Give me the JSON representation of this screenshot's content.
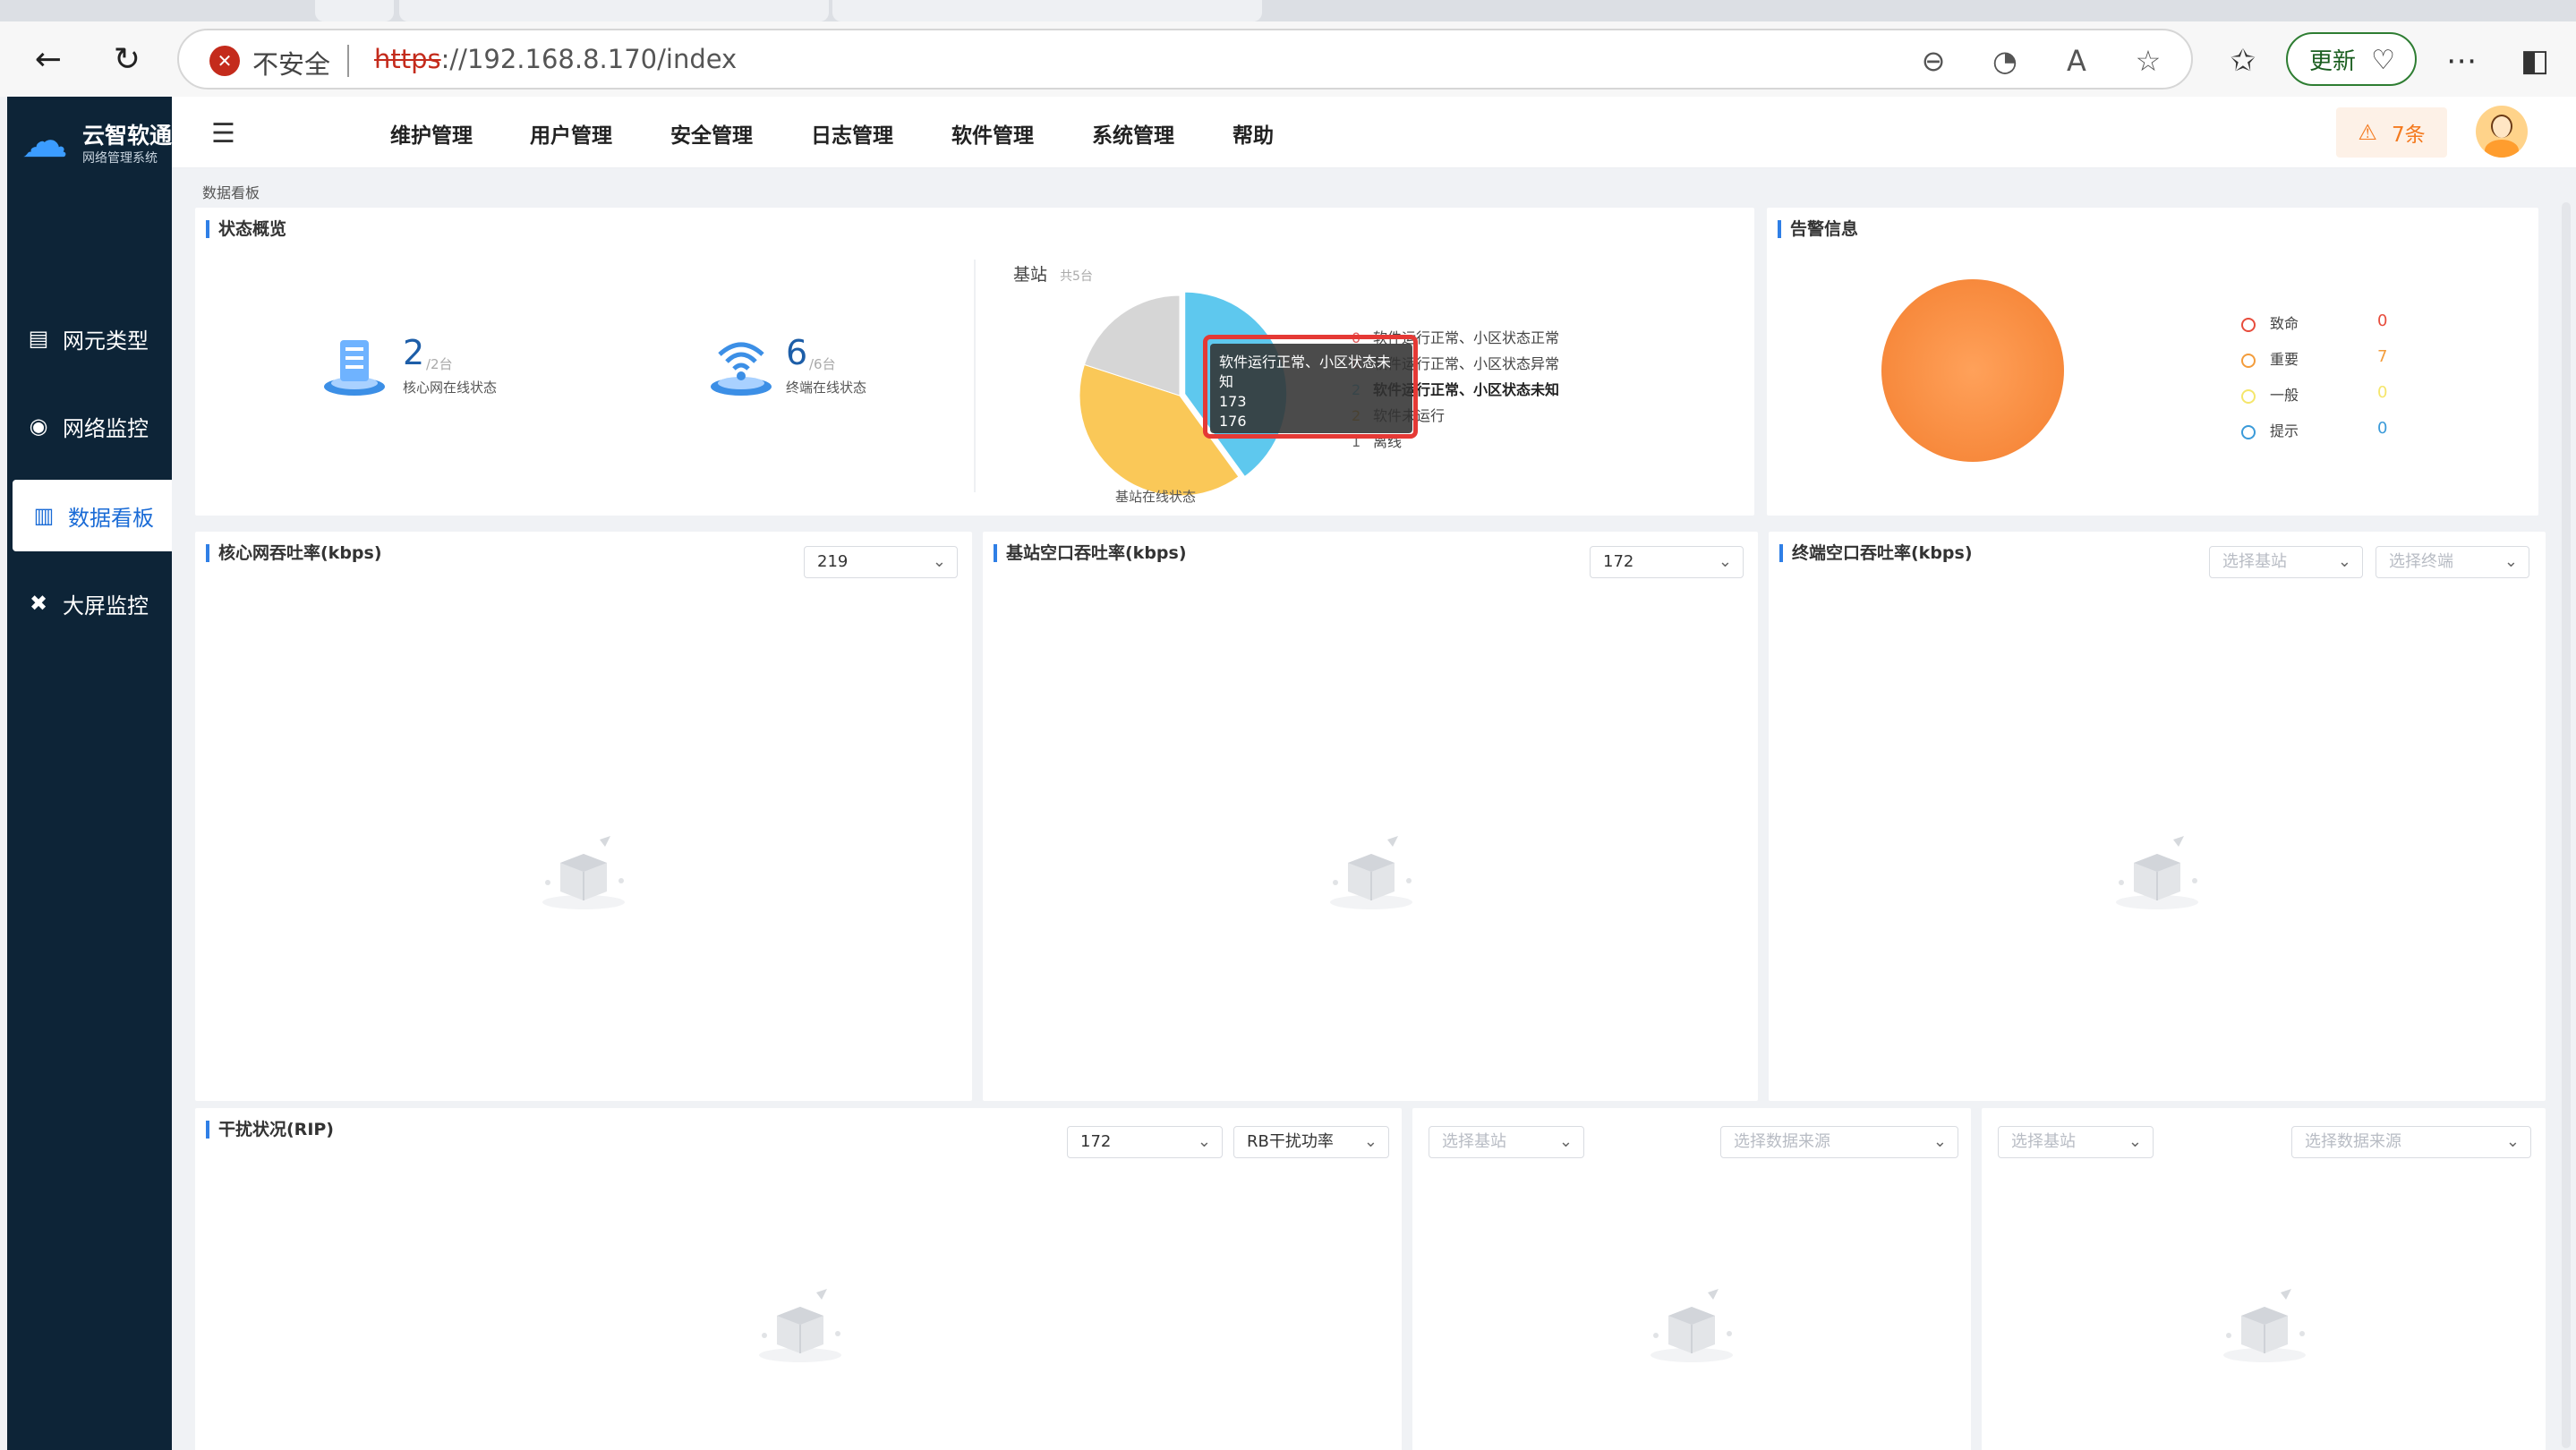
{
  "browser": {
    "insecure_label": "不安全",
    "url_scheme": "https",
    "url_rest": "://192.168.8.170/index",
    "update_label": "更新"
  },
  "app": {
    "logo_title": "云智软通",
    "logo_subtitle": "网络管理系统",
    "sidebar": [
      {
        "label": "网元类型",
        "icon": "server-icon"
      },
      {
        "label": "网络监控",
        "icon": "monitor-icon"
      },
      {
        "label": "数据看板",
        "icon": "chart-icon"
      },
      {
        "label": "大屏监控",
        "icon": "expand-icon"
      }
    ],
    "menu": [
      "维护管理",
      "用户管理",
      "安全管理",
      "日志管理",
      "软件管理",
      "系统管理",
      "帮助"
    ],
    "alarm_count": "7条",
    "breadcrumb": "数据看板"
  },
  "status": {
    "title": "状态概览",
    "core": {
      "value": "2",
      "total": "/2台",
      "label": "核心网在线状态"
    },
    "terminal": {
      "value": "6",
      "total": "/6台",
      "label": "终端在线状态"
    },
    "bs_title": "基站",
    "bs_total": "共5台",
    "bs_caption": "基站在线状态",
    "legend": [
      {
        "count": "0",
        "label": "软件运行正常、小区状态正常",
        "color": "#91cc75"
      },
      {
        "count": "0",
        "label": "软件运行正常、小区状态异常",
        "color": "#ee6666"
      },
      {
        "count": "2",
        "label": "软件运行正常、小区状态未知",
        "color": "#5ec8ee"
      },
      {
        "count": "2",
        "label": "软件未运行",
        "color": "#fac858"
      },
      {
        "count": "1",
        "label": "离线",
        "color": "#d6d6d6"
      }
    ],
    "tooltip": {
      "title": "软件运行正常、小区状态未知",
      "line1": "173",
      "line2": "176"
    }
  },
  "alarms": {
    "title": "告警信息",
    "rows": [
      {
        "label": "致命",
        "value": "0",
        "color": "#e74c3c"
      },
      {
        "label": "重要",
        "value": "7",
        "color": "#f39c3b"
      },
      {
        "label": "一般",
        "value": "0",
        "color": "#f5e66b"
      },
      {
        "label": "提示",
        "value": "0",
        "color": "#3a9ad9"
      }
    ]
  },
  "panels": {
    "core_tp": {
      "title": "核心网吞吐率(kbps)",
      "select": "219"
    },
    "bs_tp": {
      "title": "基站空口吞吐率(kbps)",
      "select": "172"
    },
    "term_tp": {
      "title": "终端空口吞吐率(kbps)",
      "ph1": "选择基站",
      "ph2": "选择终端"
    },
    "rip": {
      "title": "干扰状况(RIP)",
      "select1": "172",
      "select2": "RB干扰功率"
    },
    "p5": {
      "ph1": "选择基站",
      "ph2": "选择数据来源"
    },
    "p6": {
      "ph1": "选择基站",
      "ph2": "选择数据来源"
    }
  },
  "chart_data": {
    "type": "pie",
    "title": "基站",
    "subtitle": "共5台",
    "caption": "基站在线状态",
    "categories": [
      "软件运行正常、小区状态正常",
      "软件运行正常、小区状态异常",
      "软件运行正常、小区状态未知",
      "软件未运行",
      "离线"
    ],
    "values": [
      0,
      0,
      2,
      2,
      1
    ],
    "colors": [
      "#91cc75",
      "#ee6666",
      "#5ec8ee",
      "#fac858",
      "#d6d6d6"
    ],
    "legend": "right"
  }
}
